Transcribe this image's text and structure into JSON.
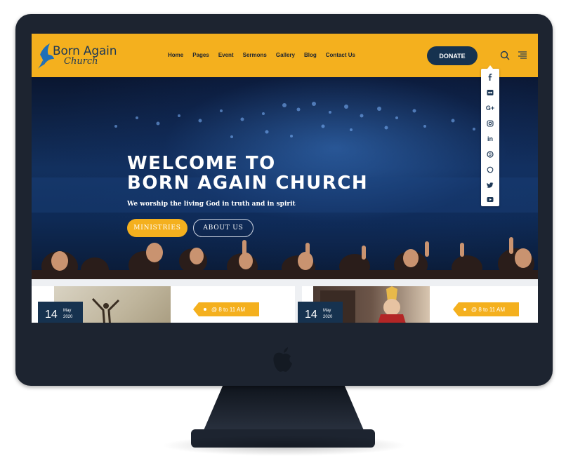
{
  "site": {
    "logo_top": "Born Again",
    "logo_bottom": "Church"
  },
  "nav": [
    "Home",
    "Pages",
    "Event",
    "Sermons",
    "Gallery",
    "Blog",
    "Contact Us"
  ],
  "header": {
    "donate_label": "DONATE",
    "search_icon": "search-icon",
    "menu_icon": "hamburger-menu-icon"
  },
  "social": [
    "facebook-icon",
    "flickr-icon",
    "google-plus-icon",
    "instagram-icon",
    "linkedin-icon",
    "skype-icon",
    "whatsapp-icon",
    "twitter-icon",
    "youtube-icon"
  ],
  "hero": {
    "title_line1": "WELCOME TO",
    "title_line2": "BORN AGAIN CHURCH",
    "subtitle": "We worship the living God in truth and in spirit",
    "btn_primary": "MINISTRIES",
    "btn_secondary": "ABOUT US"
  },
  "events": [
    {
      "day": "14",
      "month": "May",
      "year": "2020",
      "time": "@ 8 to 11 AM"
    },
    {
      "day": "14",
      "month": "May",
      "year": "2020",
      "time": "@ 8 to 11 AM"
    }
  ],
  "colors": {
    "accent": "#f4b01e",
    "navy": "#16324f",
    "bezel": "#1d2430"
  }
}
